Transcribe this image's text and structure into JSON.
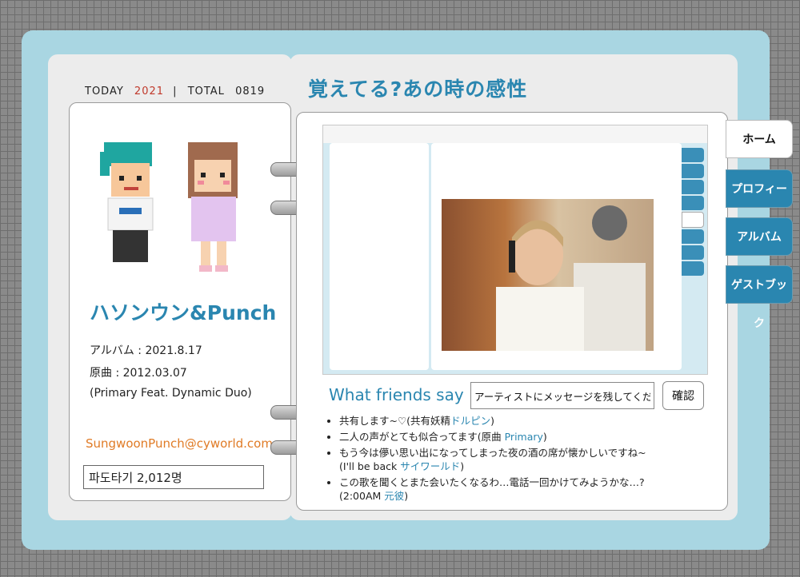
{
  "counter": {
    "today_label": "TODAY",
    "today_value": "2021",
    "separator": "|",
    "total_label": "TOTAL",
    "total_value": "0819"
  },
  "profile": {
    "name": "ハソンウン&Punch",
    "album_line": "アルバム : 2021.8.17",
    "original_line": "原曲 : 2012.03.07",
    "credit_line": "(Primary Feat. Dynamic Duo)",
    "email": "SungwoonPunch@cyworld.com",
    "wave_count": "파도타기 2,012명"
  },
  "headline": "覚えてる?あの時の感性",
  "nav_tabs": [
    {
      "label": "ホーム",
      "active": true
    },
    {
      "label": "プロフィール",
      "active": false
    },
    {
      "label": "アルバム",
      "active": false
    },
    {
      "label": "ゲストブック",
      "active": false
    }
  ],
  "friends_section": {
    "title": "What friends say",
    "input_value": "アーティストにメッセージを残してください",
    "confirm_label": "確認",
    "comments": [
      {
        "line1": "共有します~♡(共有妖精",
        "hl1": "ドルピン",
        "line1_end": ")",
        "line2": "",
        "hl2": "",
        "line2_end": ""
      },
      {
        "line1": "二人の声がとても似合ってます(原曲 ",
        "hl1": "Primary",
        "line1_end": ")",
        "line2": "",
        "hl2": "",
        "line2_end": ""
      },
      {
        "line1": "もう今は儚い思い出になってしまった夜の酒の席が懐かしいですね~",
        "hl1": "",
        "line1_end": "",
        "line2": "(I'll be back ",
        "hl2": "サイワールド",
        "line2_end": ")"
      },
      {
        "line1": "この歌を聞くとまた会いたくなるわ…電話一回かけてみようかな…?",
        "hl1": "",
        "line1_end": "",
        "line2": "(2:00AM ",
        "hl2": "元彼",
        "line2_end": ")"
      }
    ]
  },
  "colors": {
    "accent": "#2a86b0",
    "frame": "#a9d6e2",
    "email": "#e07b26",
    "today": "#c0392b"
  }
}
